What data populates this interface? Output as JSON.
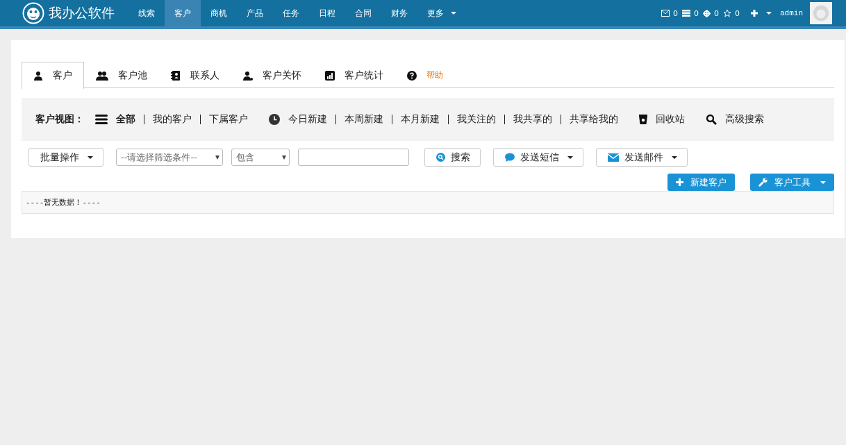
{
  "navbar": {
    "brand": "我办公软件",
    "items": [
      {
        "label": "线索",
        "selected": false
      },
      {
        "label": "客户",
        "selected": true
      },
      {
        "label": "商机",
        "selected": false
      },
      {
        "label": "产品",
        "selected": false
      },
      {
        "label": "任务",
        "selected": false
      },
      {
        "label": "日程",
        "selected": false
      },
      {
        "label": "合同",
        "selected": false
      },
      {
        "label": "财务",
        "selected": false
      }
    ],
    "more": "更多",
    "counters": [
      "0",
      "0",
      "0",
      "0"
    ],
    "user": "admin"
  },
  "tabs": [
    {
      "label": "客户",
      "selected": true,
      "kind": "normal"
    },
    {
      "label": "客户池",
      "selected": false,
      "kind": "normal"
    },
    {
      "label": "联系人",
      "selected": false,
      "kind": "normal"
    },
    {
      "label": "客户关怀",
      "selected": false,
      "kind": "normal"
    },
    {
      "label": "客户统计",
      "selected": false,
      "kind": "normal"
    },
    {
      "label": "帮助",
      "selected": false,
      "kind": "help"
    }
  ],
  "view_bar": {
    "label": "客户视图：",
    "groups": [
      [
        {
          "label": "全部",
          "selected": true
        },
        {
          "label": "我的客户",
          "selected": false
        },
        {
          "label": "下属客户",
          "selected": false
        }
      ],
      [
        {
          "label": "今日新建",
          "selected": false
        },
        {
          "label": "本周新建",
          "selected": false
        },
        {
          "label": "本月新建",
          "selected": false
        },
        {
          "label": "我关注的",
          "selected": false
        },
        {
          "label": "我共享的",
          "selected": false
        },
        {
          "label": "共享给我的",
          "selected": false
        }
      ],
      [
        {
          "label": "回收站",
          "selected": false
        }
      ],
      [
        {
          "label": "高级搜索",
          "selected": false
        }
      ]
    ]
  },
  "toolbar": {
    "batch": "批量操作",
    "filter_select": "--请选择筛选条件--",
    "operator_select": "包含",
    "search_button": "搜索",
    "sms_button": "发送短信",
    "mail_button": "发送邮件"
  },
  "actions": {
    "new_customer": "新建客户",
    "customer_tools": "客户工具"
  },
  "table": {
    "empty_message": "----暂无数据！----"
  }
}
